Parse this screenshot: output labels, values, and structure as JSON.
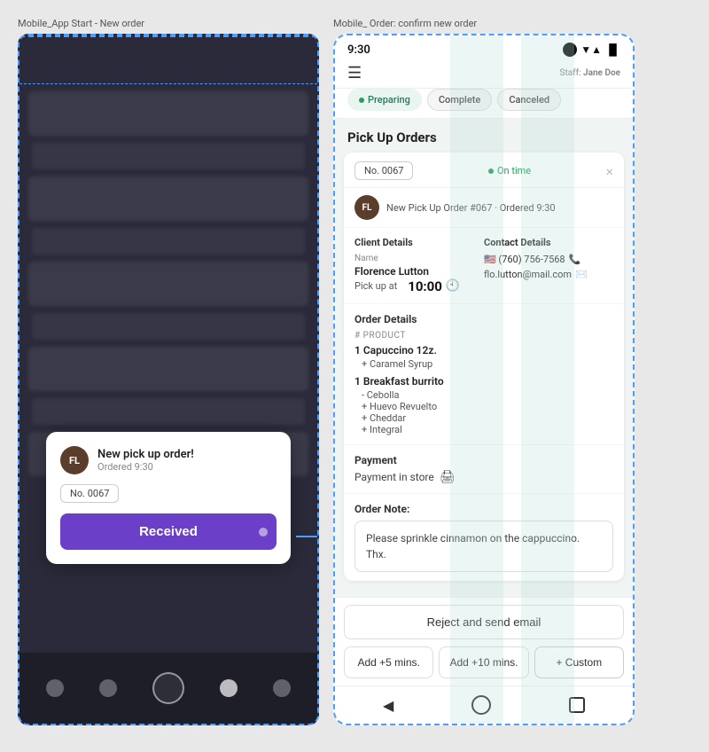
{
  "left_panel": {
    "label": "Mobile_App Start - New order",
    "notification": {
      "avatar_initials": "FL",
      "title": "New pick up order!",
      "subtitle": "Ordered 9:30",
      "order_number": "No. 0067",
      "button_label": "Received"
    }
  },
  "right_panel": {
    "label": "Mobile_ Order: confirm new order",
    "status_bar": {
      "time": "9:30"
    },
    "header": {
      "staff_prefix": "Staff:",
      "staff_name": "Jane Doe"
    },
    "tabs": [
      {
        "label": "Preparing",
        "active": true
      },
      {
        "label": "Complete",
        "active": false
      },
      {
        "label": "Canceled",
        "active": false
      }
    ],
    "section_title": "Pick Up Orders",
    "order": {
      "order_number": "No. 0067",
      "on_time_label": "On time",
      "close_icon": "×",
      "avatar_initials": "FL",
      "order_subtitle": "New Pick Up Order #067 · Ordered 9:30",
      "client_details_heading": "Client Details",
      "client_name_label": "Name",
      "client_name": "Florence Lutton",
      "pickup_label": "Pick up at",
      "pickup_time": "10:00",
      "contact_details_heading": "Contact Details",
      "phone": "🇺🇸 (760) 756-7568",
      "email": "flo.lutton@mail.com",
      "order_details_heading": "Order Details",
      "product_col_label": "# Product",
      "items": [
        {
          "qty": "1",
          "name": "Capuccino 12z.",
          "addons": [
            "+ Caramel Syrup"
          ]
        },
        {
          "qty": "1",
          "name": "Breakfast burrito",
          "addons": [
            "- Cebolla",
            "+ Huevo Revuelto",
            "+ Cheddar",
            "+ Integral"
          ]
        }
      ],
      "payment_heading": "Payment",
      "payment_method": "Payment in store",
      "order_note_heading": "Order Note:",
      "order_note": "Please sprinkle cinnamon on the cappuccino. Thx.",
      "reject_btn_label": "Reject and send email",
      "add_5_label": "Add +5 mins.",
      "add_10_label": "Add +10 mins.",
      "custom_label": "+ Custom"
    }
  }
}
